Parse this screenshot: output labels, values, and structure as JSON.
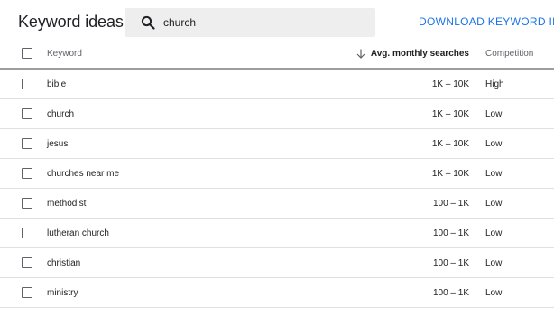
{
  "header": {
    "title": "Keyword ideas",
    "search": {
      "value": "church",
      "placeholder": ""
    },
    "download_label": "DOWNLOAD KEYWORD IDEAS"
  },
  "table": {
    "columns": {
      "keyword": "Keyword",
      "searches": "Avg. monthly searches",
      "competition": "Competition"
    },
    "rows": [
      {
        "keyword": "bible",
        "searches": "1K – 10K",
        "competition": "High"
      },
      {
        "keyword": "church",
        "searches": "1K – 10K",
        "competition": "Low"
      },
      {
        "keyword": "jesus",
        "searches": "1K – 10K",
        "competition": "Low"
      },
      {
        "keyword": "churches near me",
        "searches": "1K – 10K",
        "competition": "Low"
      },
      {
        "keyword": "methodist",
        "searches": "100 – 1K",
        "competition": "Low"
      },
      {
        "keyword": "lutheran church",
        "searches": "100 – 1K",
        "competition": "Low"
      },
      {
        "keyword": "christian",
        "searches": "100 – 1K",
        "competition": "Low"
      },
      {
        "keyword": "ministry",
        "searches": "100 – 1K",
        "competition": "Low"
      }
    ]
  },
  "icons": {
    "search": "search-icon",
    "sort": "arrow-down-icon",
    "checkbox": "checkbox-unchecked-icon"
  },
  "colors": {
    "accent": "#1a73e8",
    "search_bg": "#eeeeee",
    "header_rule": "#9e9e9e",
    "row_divider": "#e0e0e0"
  }
}
